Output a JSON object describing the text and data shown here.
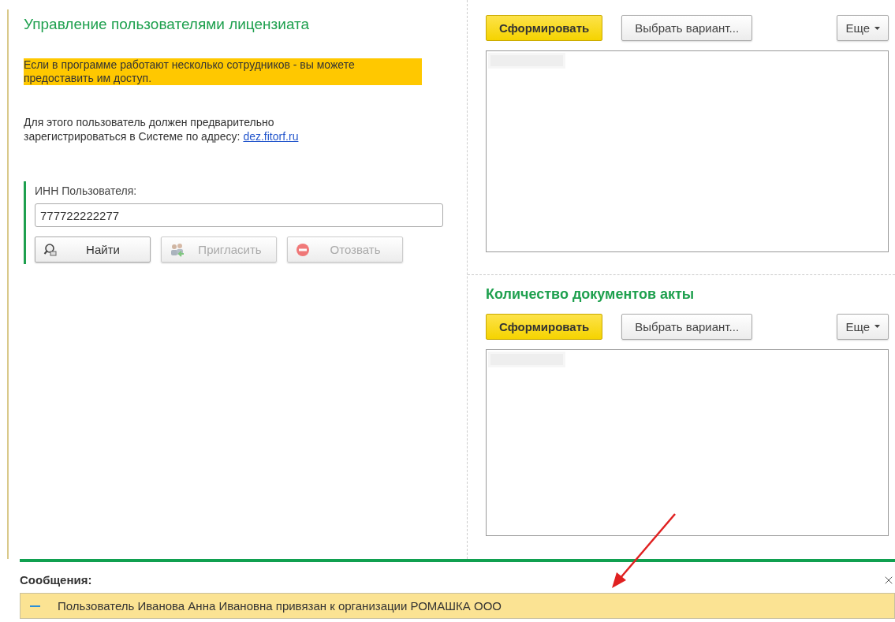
{
  "left_panel": {
    "title": "Управление пользователями лицензиата",
    "notice": "Если в программе работают несколько сотрудников - вы можете предоставить им доступ.",
    "info": {
      "text": "Для этого пользователь должен предварительно зарегистрироваться в Системе по адресу:",
      "link": "dez.fitorf.ru"
    },
    "inn_field": {
      "label": "ИНН Пользователя:",
      "value": "777722222277"
    },
    "buttons": [
      {
        "kind": "find",
        "label": "Найти",
        "disabled": false
      },
      {
        "kind": "invite",
        "label": "Пригласить",
        "disabled": true
      },
      {
        "kind": "revoke",
        "label": "Отозвать",
        "disabled": true
      }
    ]
  },
  "reports": [
    {
      "generate": "Сформировать",
      "choose_variant": "Выбрать вариант...",
      "more": "Еще"
    },
    {
      "title": "Количество документов акты",
      "generate": "Сформировать",
      "choose_variant": "Выбрать вариант...",
      "more": "Еще"
    }
  ],
  "messages": {
    "title": "Сообщения:",
    "items": [
      {
        "text": "Пользователь Иванова Анна Ивановна привязан к организации РОМАШКА ООО"
      }
    ]
  }
}
